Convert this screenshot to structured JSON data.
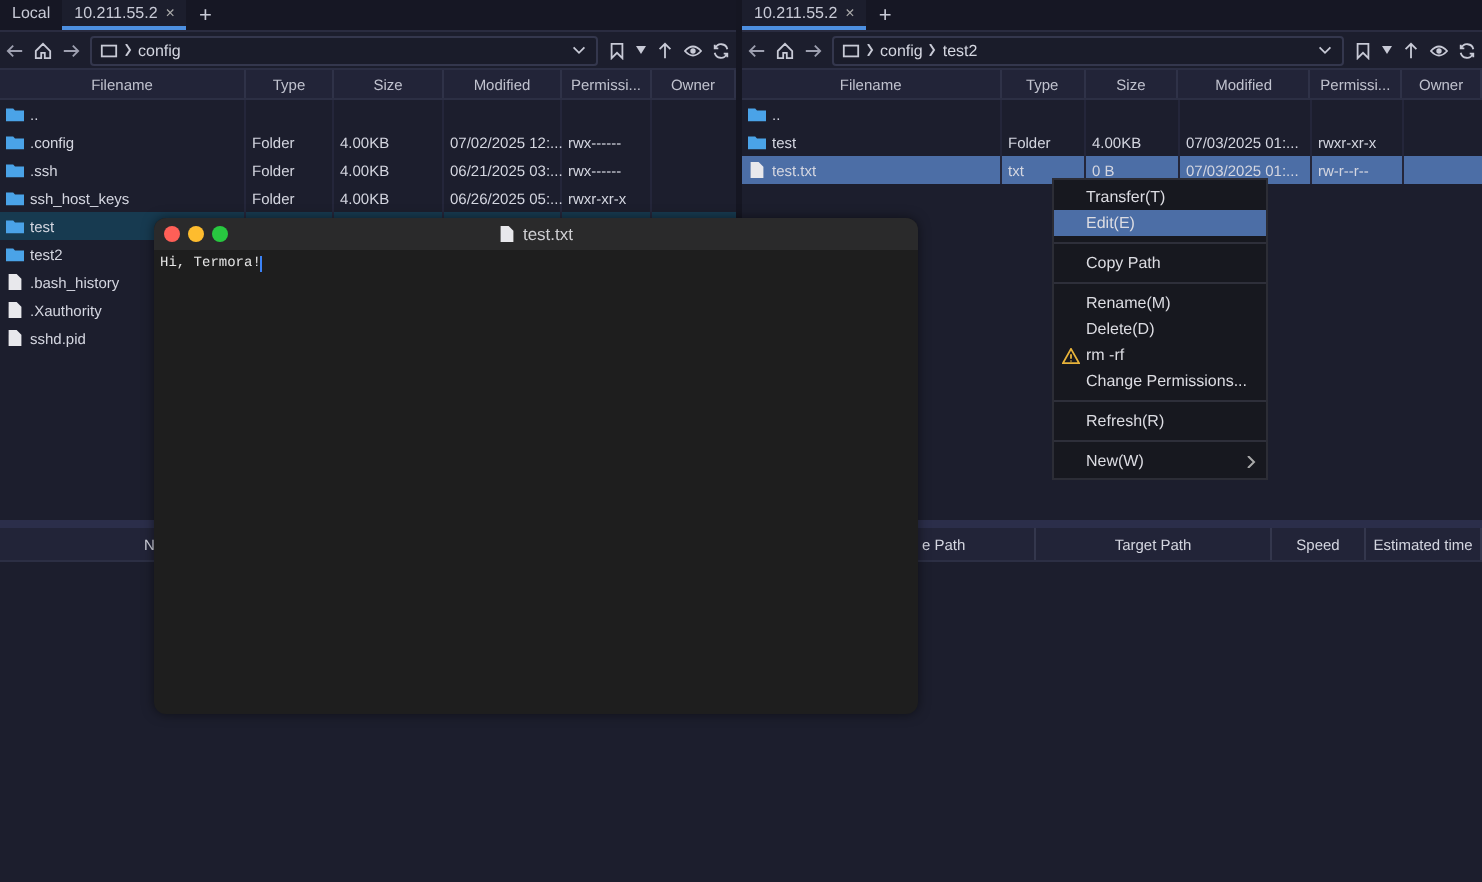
{
  "panes": [
    {
      "tabs": [
        {
          "label": "Local",
          "selected": false
        },
        {
          "label": "10.211.55.2",
          "selected": true,
          "close": "×"
        }
      ],
      "add_tab": "+",
      "path": [
        "config"
      ],
      "columns": [
        "Filename",
        "Type",
        "Size",
        "Modified",
        "Permissi...",
        "Owner"
      ],
      "rows": [
        {
          "name": "..",
          "kind": "folder",
          "selected": false
        },
        {
          "name": ".config",
          "kind": "folder",
          "selected": false,
          "type": "Folder",
          "size": "4.00KB",
          "modified": "07/02/2025 12:...",
          "permissions": "rwx------"
        },
        {
          "name": ".ssh",
          "kind": "folder",
          "selected": false,
          "type": "Folder",
          "size": "4.00KB",
          "modified": "06/21/2025 03:...",
          "permissions": "rwx------"
        },
        {
          "name": "ssh_host_keys",
          "kind": "folder",
          "selected": false,
          "type": "Folder",
          "size": "4.00KB",
          "modified": "06/26/2025 05:...",
          "permissions": "rwxr-xr-x"
        },
        {
          "name": "test",
          "kind": "folder",
          "selected": true
        },
        {
          "name": "test2",
          "kind": "folder",
          "selected": false
        },
        {
          "name": ".bash_history",
          "kind": "file",
          "selected": false
        },
        {
          "name": ".Xauthority",
          "kind": "file",
          "selected": false
        },
        {
          "name": "sshd.pid",
          "kind": "file",
          "selected": false
        }
      ]
    },
    {
      "tabs": [
        {
          "label": "10.211.55.2",
          "selected": true,
          "close": "×"
        }
      ],
      "add_tab": "+",
      "path": [
        "config",
        "test2"
      ],
      "columns": [
        "Filename",
        "Type",
        "Size",
        "Modified",
        "Permissi...",
        "Owner"
      ],
      "rows": [
        {
          "name": "..",
          "kind": "folder",
          "selected": false
        },
        {
          "name": "test",
          "kind": "folder",
          "selected": false,
          "type": "Folder",
          "size": "4.00KB",
          "modified": "07/03/2025 01:...",
          "permissions": "rwxr-xr-x"
        },
        {
          "name": "test.txt",
          "kind": "file",
          "selected": true,
          "type": "txt",
          "size": "0 B",
          "modified": "07/03/2025 01:...",
          "permissions": "rw-r--r--"
        }
      ]
    }
  ],
  "context_menu": {
    "sections": [
      [
        {
          "label": "Transfer(T)",
          "kind": "plain",
          "selected": false
        },
        {
          "label": "Edit(E)",
          "kind": "plain",
          "selected": true
        }
      ],
      [
        {
          "label": "Copy Path",
          "kind": "plain",
          "selected": false
        }
      ],
      [
        {
          "label": "Rename(M)",
          "kind": "plain",
          "selected": false
        },
        {
          "label": "Delete(D)",
          "kind": "plain",
          "selected": false
        },
        {
          "label": "rm -rf",
          "kind": "warning",
          "selected": false
        },
        {
          "label": "Change Permissions...",
          "kind": "plain",
          "selected": false
        }
      ],
      [
        {
          "label": "Refresh(R)",
          "kind": "plain",
          "selected": false
        }
      ],
      [
        {
          "label": "New(W)",
          "kind": "submenu",
          "selected": false
        }
      ]
    ]
  },
  "transfers": {
    "columns": [
      "N",
      "e Path",
      "Target Path",
      "Speed",
      "Estimated time"
    ]
  },
  "editor": {
    "title": "test.txt",
    "content": "Hi, Termora!"
  }
}
